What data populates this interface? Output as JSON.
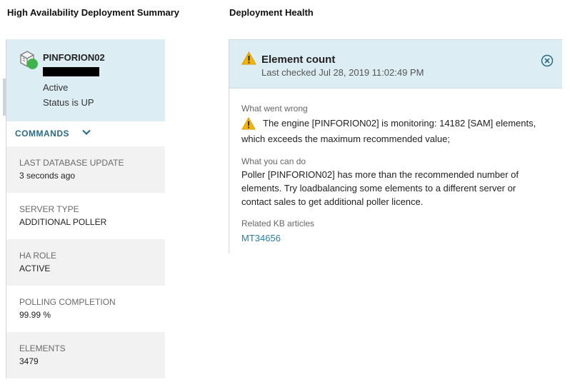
{
  "headings": {
    "left": "High Availability Deployment Summary",
    "right": "Deployment Health"
  },
  "server": {
    "name": "PINFORION02",
    "state": "Active",
    "status": "Status is UP",
    "status_color": "#3cb44b",
    "icon": "server-icon"
  },
  "commands": {
    "label": "COMMANDS",
    "icon": "chevron-down-icon"
  },
  "properties": [
    {
      "label": "LAST DATABASE UPDATE",
      "value": "3 seconds ago"
    },
    {
      "label": "SERVER TYPE",
      "value": "ADDITIONAL POLLER"
    },
    {
      "label": "HA ROLE",
      "value": "ACTIVE"
    },
    {
      "label": "POLLING COMPLETION",
      "value": "99.99 %"
    },
    {
      "label": "ELEMENTS",
      "value": "3479"
    }
  ],
  "alert": {
    "title": "Element count",
    "last_checked": "Last checked Jul 28, 2019 11:02:49 PM",
    "what_went_wrong_label": "What went wrong",
    "what_went_wrong_line1": "The engine [PINFORION02] is monitoring: 14182 [SAM] elements,",
    "what_went_wrong_line2": "which exceeds the maximum recommended value;",
    "what_you_can_do_label": "What you can do",
    "what_you_can_do_line1": "Poller [PINFORION02] has more than the recommended number of",
    "what_you_can_do_line2": "elements. Try loadbalancing some elements to a different server or",
    "what_you_can_do_line3": "contact sales to get additional poller licence.",
    "related_kb_label": "Related KB articles",
    "kb_link": "MT34656",
    "warning_color": "#f5b400",
    "accent_color": "#2b7ea1"
  }
}
